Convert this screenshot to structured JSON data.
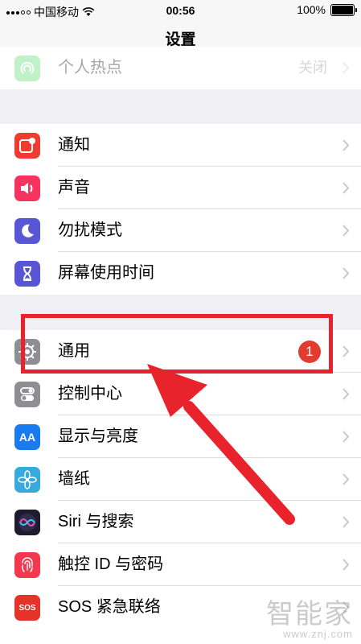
{
  "status_bar": {
    "carrier": "中国移动",
    "time": "00:56",
    "battery": "100%"
  },
  "nav": {
    "title": "设置"
  },
  "sections": [
    [
      {
        "label": "个人热点",
        "value": "关闭",
        "icon": "hotspot-icon",
        "color": "#4cd964"
      }
    ],
    [
      {
        "label": "通知",
        "icon": "notification-icon",
        "color": "#f23b30"
      },
      {
        "label": "声音",
        "icon": "sound-icon",
        "color": "#f7345f"
      },
      {
        "label": "勿扰模式",
        "icon": "moon-icon",
        "color": "#5956d6"
      },
      {
        "label": "屏幕使用时间",
        "icon": "hourglass-icon",
        "color": "#5956d6"
      }
    ],
    [
      {
        "label": "通用",
        "icon": "gear-icon",
        "color": "#8e8e93",
        "badge": "1"
      },
      {
        "label": "控制中心",
        "icon": "toggle-icon",
        "color": "#8e8e93"
      },
      {
        "label": "显示与亮度",
        "icon": "text-size-icon",
        "color": "#1a7af0",
        "glyph": "AA"
      },
      {
        "label": "墙纸",
        "icon": "flower-icon",
        "color": "#36aadc"
      },
      {
        "label": "Siri 与搜索",
        "icon": "siri-icon",
        "color": "#1c1c2e"
      },
      {
        "label": "触控 ID 与密码",
        "icon": "fingerprint-icon",
        "color": "#f5384e"
      },
      {
        "label": "SOS 紧急联络",
        "icon": "sos-icon",
        "color": "#e5332a",
        "glyph": "SOS"
      }
    ]
  ],
  "watermark": {
    "main": "智能家",
    "sub": "www.znj.com"
  },
  "annotation_color": "#e8232b"
}
